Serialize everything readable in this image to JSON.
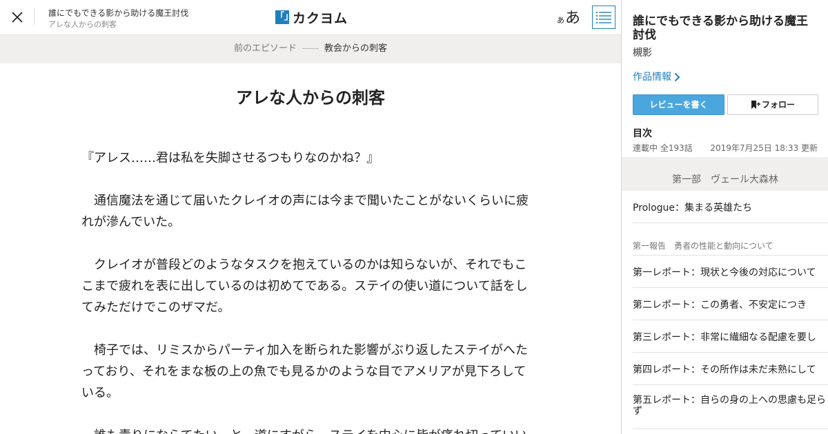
{
  "header": {
    "work_title": "誰にでもできる影から助ける魔王討伐",
    "episode_subtitle": "アレな人からの刺客",
    "logo_mark": "「」",
    "logo_text": "カクヨム",
    "font_small": "あ",
    "font_large": "あ"
  },
  "prev_bar": {
    "label": "前のエピソード",
    "title": "教会からの刺客"
  },
  "episode": {
    "title": "アレな人からの刺客",
    "paragraphs": [
      "『アレス……君は私を失脚させるつもりなのかね？』",
      "　通信魔法を通じて届いたクレイオの声には今まで聞いたことがないくらいに疲れが滲んでいた。",
      "　クレイオが普段どのようなタスクを抱えているのかは知らないが、それでもここまで疲れを表に出しているのは初めてである。ステイの使い道について話をしてみただけでこのザマだ。",
      "　椅子では、リミスからパーティ加入を断られた影響がぶり返したステイがへたっており、それをまな板の上の魚でも見るかのような目でアメリアが見下ろしている。",
      "　誰も責りにならてたい…と、道にすがら、ステイを中心に皆が痛れ切っていい"
    ]
  },
  "sidebar": {
    "title": "誰にでもできる影から助ける魔王討伐",
    "author": "槻影",
    "info_link": "作品情報",
    "review_button": "レビューを書く",
    "follow_button": "フォロー",
    "toc_heading": "目次",
    "status": "連載中 全193話",
    "updated": "2019年7月25日 18:33 更新",
    "part_header": "第一部　ヴェール大森林",
    "episodes": [
      "Prologue：集まる英雄たち"
    ],
    "section_label": "第一報告　勇者の性能と動向について",
    "section_episodes": [
      "第一レポート：現状と今後の対応について",
      "第二レポート：この勇者、不安定につき",
      "第三レポート：非常に繊細なる配慮を要し",
      "第四レポート：その所作は未だ未熟にして",
      "第五レポート：自らの身の上への思慮も足らず"
    ]
  },
  "colors": {
    "accent": "#1f7fbd",
    "review_button_bg": "#4ba6de",
    "bar_bg": "#f0efee"
  },
  "icons": {
    "close": "close-icon",
    "toc": "list-icon",
    "chevron": "chevron-right-icon",
    "bookmark": "bookmark-plus-icon"
  }
}
